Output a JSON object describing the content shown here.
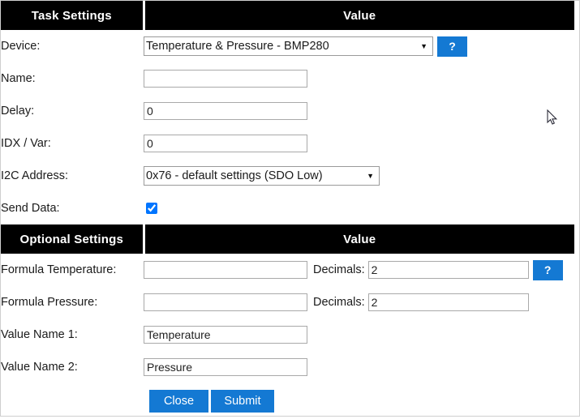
{
  "sections": {
    "task": {
      "header_left": "Task Settings",
      "header_right": "Value",
      "rows": {
        "device": {
          "label": "Device:",
          "value": "Temperature & Pressure - BMP280",
          "help": "?"
        },
        "name": {
          "label": "Name:",
          "value": "",
          "placeholder": ""
        },
        "delay": {
          "label": "Delay:",
          "value": "0"
        },
        "idx_var": {
          "label": "IDX / Var:",
          "value": "0"
        },
        "i2c_address": {
          "label": "I2C Address:",
          "value": "0x76 - default settings (SDO Low)"
        },
        "send_data": {
          "label": "Send Data:",
          "checked": true
        }
      }
    },
    "optional": {
      "header_left": "Optional Settings",
      "header_right": "Value",
      "rows": {
        "formula_temperature": {
          "label": "Formula Temperature:",
          "value": "",
          "decimals_label": "Decimals:",
          "decimals_value": "2",
          "help": "?"
        },
        "formula_pressure": {
          "label": "Formula Pressure:",
          "value": "",
          "decimals_label": "Decimals:",
          "decimals_value": "2"
        },
        "value_name_1": {
          "label": "Value Name 1:",
          "value": "Temperature"
        },
        "value_name_2": {
          "label": "Value Name 2:",
          "value": "Pressure"
        }
      }
    }
  },
  "buttons": {
    "close": "Close",
    "submit": "Submit"
  },
  "colors": {
    "accent_blue": "#1479d3",
    "header_black": "#000000",
    "page_background": "#ffffff"
  }
}
